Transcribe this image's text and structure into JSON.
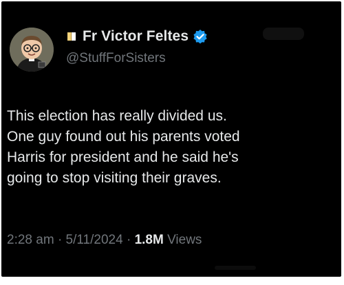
{
  "tweet": {
    "display_name": "Fr Victor Feltes",
    "handle": "@StuffForSisters",
    "text": "This election has really divided us.\nOne guy found out his parents voted\nHarris for president and he said he's\ngoing to stop visiting their graves.",
    "time": "2:28 am",
    "separator": "·",
    "date": "5/11/2024",
    "views_count": "1.8M",
    "views_label": "Views"
  },
  "icons": {
    "name_prefix": "book-icon",
    "verified": "verified-badge-icon",
    "avatar": "avatar-cartoon-priest"
  },
  "colors": {
    "background": "#000000",
    "primary_text": "#e7e9ea",
    "secondary_text": "#71767b",
    "verified_blue": "#1d9bf0"
  }
}
